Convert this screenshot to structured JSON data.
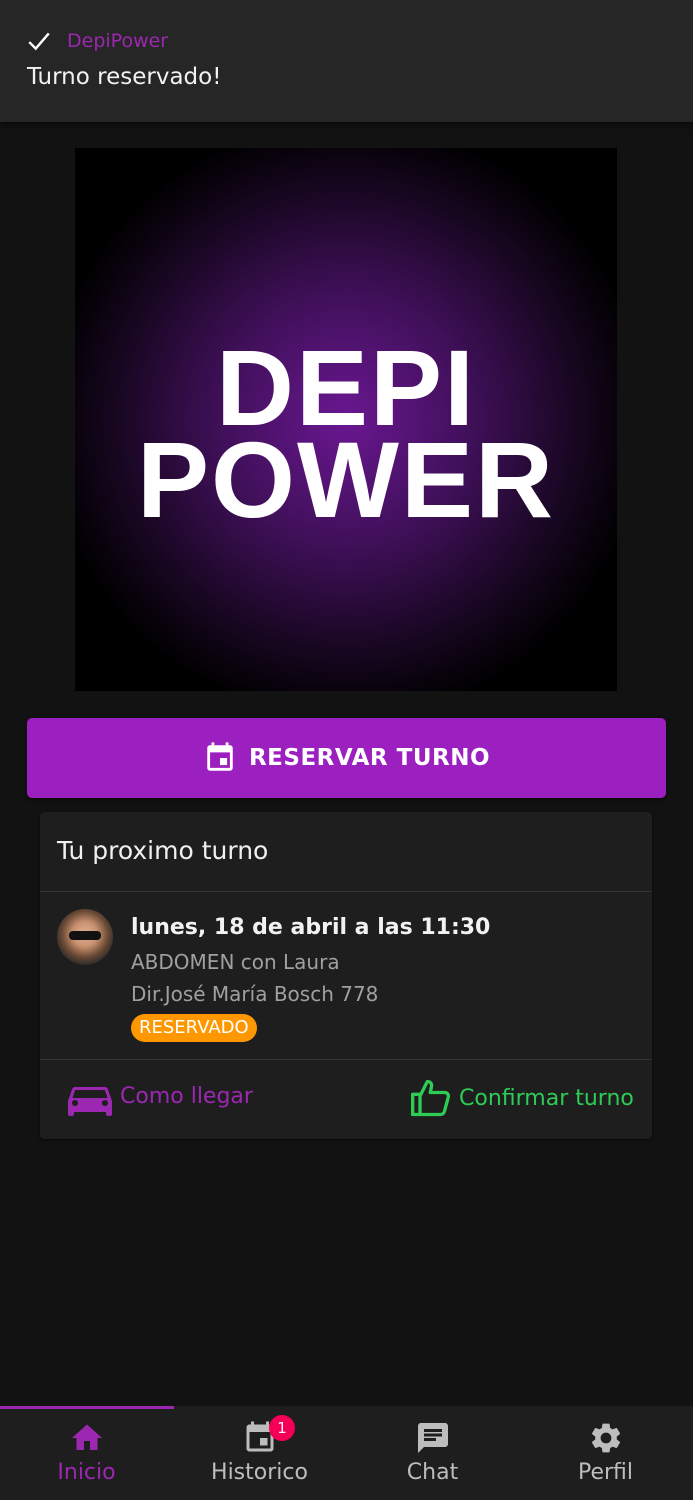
{
  "toast": {
    "app_name": "DepiPower",
    "message": "Turno reservado!",
    "icon": "check-icon"
  },
  "logo": {
    "line1": "DEPI",
    "line2": "POWER"
  },
  "reserve_button": {
    "label": "RESERVAR TURNO",
    "icon": "calendar-icon"
  },
  "next_appointment": {
    "title": "Tu proximo turno",
    "date": "lunes, 18 de abril a las 11:30",
    "service": "ABDOMEN con Laura",
    "address": "Dir.José María Bosch 778",
    "status": "RESERVADO",
    "actions": {
      "directions": "Como llegar",
      "confirm": "Confirmar turno"
    }
  },
  "bottom_nav": {
    "items": [
      {
        "label": "Inicio",
        "icon": "home-icon",
        "active": true
      },
      {
        "label": "Historico",
        "icon": "calendar-history-icon",
        "badge": "1"
      },
      {
        "label": "Chat",
        "icon": "chat-icon"
      },
      {
        "label": "Perfil",
        "icon": "gear-icon"
      }
    ]
  },
  "colors": {
    "accent": "#9c27b0",
    "button": "#9c1fbf",
    "status_reserved": "#ff9800",
    "confirm": "#2ecc55",
    "badge": "#f50057",
    "background": "#121212"
  }
}
